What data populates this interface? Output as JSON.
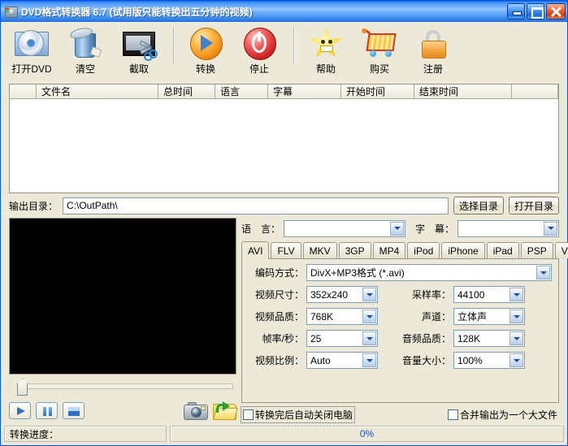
{
  "window": {
    "title": "DVD格式转换器 6.7 (试用版只能转换出五分钟的视频)",
    "icon": "dvd-disc-icon",
    "accent_color": "#4f9bf6",
    "face_color": "#ece9d8",
    "controls": {
      "minimize": "minimize-button",
      "maximize": "maximize-button",
      "close": "close-button"
    }
  },
  "toolbar": {
    "items": [
      {
        "label": "打开DVD",
        "icon": "open-dvd-icon"
      },
      {
        "label": "清空",
        "icon": "clear-trash-icon"
      },
      {
        "label": "截取",
        "icon": "clip-film-icon"
      },
      {
        "label": "转换",
        "icon": "convert-play-icon"
      },
      {
        "label": "停止",
        "icon": "stop-power-icon"
      },
      {
        "label": "帮助",
        "icon": "help-star-icon"
      },
      {
        "label": "购买",
        "icon": "buy-cart-icon"
      },
      {
        "label": "注册",
        "icon": "register-lock-icon"
      }
    ]
  },
  "file_list": {
    "columns": [
      "",
      "文件名",
      "总时间",
      "语言",
      "字幕",
      "开始时间",
      "结束时间",
      ""
    ],
    "rows": []
  },
  "output": {
    "label": "输出目录：",
    "path": "C:\\OutPath\\",
    "choose_label": "选择目录",
    "open_label": "打开目录"
  },
  "preview": {
    "play": "play-button",
    "pause": "pause-button",
    "stop": "stop-button",
    "snapshot": "camera-icon",
    "open_folder": "open-folder-icon",
    "seek_value": "0"
  },
  "stream": {
    "language_label": "语　言：",
    "language_value": "",
    "subtitle_label": "字　幕：",
    "subtitle_value": ""
  },
  "tabs": {
    "items": [
      "AVI",
      "FLV",
      "MKV",
      "3GP",
      "MP4",
      "iPod",
      "iPhone",
      "iPad",
      "PSP",
      "VCD"
    ],
    "active": "AVI",
    "scroll_left": "scroll-left-arrow",
    "scroll_right": "scroll-right-arrow"
  },
  "settings": {
    "codec": {
      "label": "编码方式：",
      "value": "DivX+MP3格式 (*.avi)"
    },
    "video_size": {
      "label": "视频尺寸：",
      "value": "352x240"
    },
    "sample_rate": {
      "label": "采样率：",
      "value": "44100"
    },
    "video_quality": {
      "label": "视频品质：",
      "value": "768K"
    },
    "channels": {
      "label": "声道：",
      "value": "立体声"
    },
    "framerate": {
      "label": "帧率/秒：",
      "value": "25"
    },
    "audio_quality": {
      "label": "音频品质：",
      "value": "128K"
    },
    "aspect": {
      "label": "视频比例：",
      "value": "Auto"
    },
    "volume": {
      "label": "音量大小：",
      "value": "100%"
    }
  },
  "checkboxes": {
    "shutdown": {
      "label": "转换完后自动关闭电脑",
      "checked": false
    },
    "merge": {
      "label": "合并输出为一个大文件",
      "checked": false
    }
  },
  "status": {
    "progress_label": "转换进度：",
    "progress_value": "0%"
  }
}
